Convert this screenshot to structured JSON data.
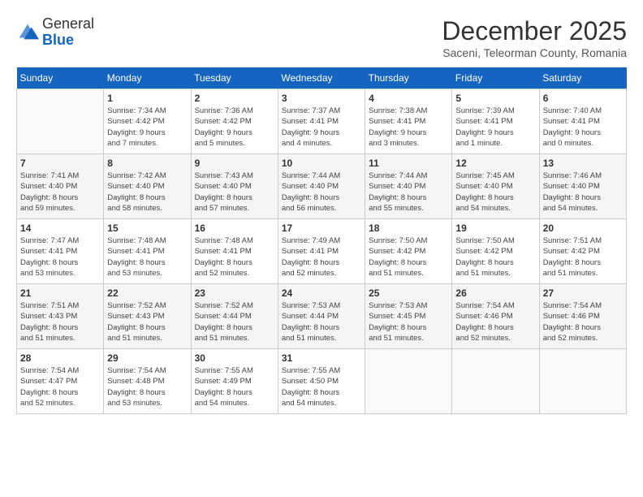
{
  "logo": {
    "general": "General",
    "blue": "Blue"
  },
  "header": {
    "title": "December 2025",
    "subtitle": "Saceni, Teleorman County, Romania"
  },
  "weekdays": [
    "Sunday",
    "Monday",
    "Tuesday",
    "Wednesday",
    "Thursday",
    "Friday",
    "Saturday"
  ],
  "weeks": [
    [
      {
        "day": "",
        "info": ""
      },
      {
        "day": "1",
        "info": "Sunrise: 7:34 AM\nSunset: 4:42 PM\nDaylight: 9 hours\nand 7 minutes."
      },
      {
        "day": "2",
        "info": "Sunrise: 7:36 AM\nSunset: 4:42 PM\nDaylight: 9 hours\nand 5 minutes."
      },
      {
        "day": "3",
        "info": "Sunrise: 7:37 AM\nSunset: 4:41 PM\nDaylight: 9 hours\nand 4 minutes."
      },
      {
        "day": "4",
        "info": "Sunrise: 7:38 AM\nSunset: 4:41 PM\nDaylight: 9 hours\nand 3 minutes."
      },
      {
        "day": "5",
        "info": "Sunrise: 7:39 AM\nSunset: 4:41 PM\nDaylight: 9 hours\nand 1 minute."
      },
      {
        "day": "6",
        "info": "Sunrise: 7:40 AM\nSunset: 4:41 PM\nDaylight: 9 hours\nand 0 minutes."
      }
    ],
    [
      {
        "day": "7",
        "info": "Sunrise: 7:41 AM\nSunset: 4:40 PM\nDaylight: 8 hours\nand 59 minutes."
      },
      {
        "day": "8",
        "info": "Sunrise: 7:42 AM\nSunset: 4:40 PM\nDaylight: 8 hours\nand 58 minutes."
      },
      {
        "day": "9",
        "info": "Sunrise: 7:43 AM\nSunset: 4:40 PM\nDaylight: 8 hours\nand 57 minutes."
      },
      {
        "day": "10",
        "info": "Sunrise: 7:44 AM\nSunset: 4:40 PM\nDaylight: 8 hours\nand 56 minutes."
      },
      {
        "day": "11",
        "info": "Sunrise: 7:44 AM\nSunset: 4:40 PM\nDaylight: 8 hours\nand 55 minutes."
      },
      {
        "day": "12",
        "info": "Sunrise: 7:45 AM\nSunset: 4:40 PM\nDaylight: 8 hours\nand 54 minutes."
      },
      {
        "day": "13",
        "info": "Sunrise: 7:46 AM\nSunset: 4:40 PM\nDaylight: 8 hours\nand 54 minutes."
      }
    ],
    [
      {
        "day": "14",
        "info": "Sunrise: 7:47 AM\nSunset: 4:41 PM\nDaylight: 8 hours\nand 53 minutes."
      },
      {
        "day": "15",
        "info": "Sunrise: 7:48 AM\nSunset: 4:41 PM\nDaylight: 8 hours\nand 53 minutes."
      },
      {
        "day": "16",
        "info": "Sunrise: 7:48 AM\nSunset: 4:41 PM\nDaylight: 8 hours\nand 52 minutes."
      },
      {
        "day": "17",
        "info": "Sunrise: 7:49 AM\nSunset: 4:41 PM\nDaylight: 8 hours\nand 52 minutes."
      },
      {
        "day": "18",
        "info": "Sunrise: 7:50 AM\nSunset: 4:42 PM\nDaylight: 8 hours\nand 51 minutes."
      },
      {
        "day": "19",
        "info": "Sunrise: 7:50 AM\nSunset: 4:42 PM\nDaylight: 8 hours\nand 51 minutes."
      },
      {
        "day": "20",
        "info": "Sunrise: 7:51 AM\nSunset: 4:42 PM\nDaylight: 8 hours\nand 51 minutes."
      }
    ],
    [
      {
        "day": "21",
        "info": "Sunrise: 7:51 AM\nSunset: 4:43 PM\nDaylight: 8 hours\nand 51 minutes."
      },
      {
        "day": "22",
        "info": "Sunrise: 7:52 AM\nSunset: 4:43 PM\nDaylight: 8 hours\nand 51 minutes."
      },
      {
        "day": "23",
        "info": "Sunrise: 7:52 AM\nSunset: 4:44 PM\nDaylight: 8 hours\nand 51 minutes."
      },
      {
        "day": "24",
        "info": "Sunrise: 7:53 AM\nSunset: 4:44 PM\nDaylight: 8 hours\nand 51 minutes."
      },
      {
        "day": "25",
        "info": "Sunrise: 7:53 AM\nSunset: 4:45 PM\nDaylight: 8 hours\nand 51 minutes."
      },
      {
        "day": "26",
        "info": "Sunrise: 7:54 AM\nSunset: 4:46 PM\nDaylight: 8 hours\nand 52 minutes."
      },
      {
        "day": "27",
        "info": "Sunrise: 7:54 AM\nSunset: 4:46 PM\nDaylight: 8 hours\nand 52 minutes."
      }
    ],
    [
      {
        "day": "28",
        "info": "Sunrise: 7:54 AM\nSunset: 4:47 PM\nDaylight: 8 hours\nand 52 minutes."
      },
      {
        "day": "29",
        "info": "Sunrise: 7:54 AM\nSunset: 4:48 PM\nDaylight: 8 hours\nand 53 minutes."
      },
      {
        "day": "30",
        "info": "Sunrise: 7:55 AM\nSunset: 4:49 PM\nDaylight: 8 hours\nand 54 minutes."
      },
      {
        "day": "31",
        "info": "Sunrise: 7:55 AM\nSunset: 4:50 PM\nDaylight: 8 hours\nand 54 minutes."
      },
      {
        "day": "",
        "info": ""
      },
      {
        "day": "",
        "info": ""
      },
      {
        "day": "",
        "info": ""
      }
    ]
  ]
}
